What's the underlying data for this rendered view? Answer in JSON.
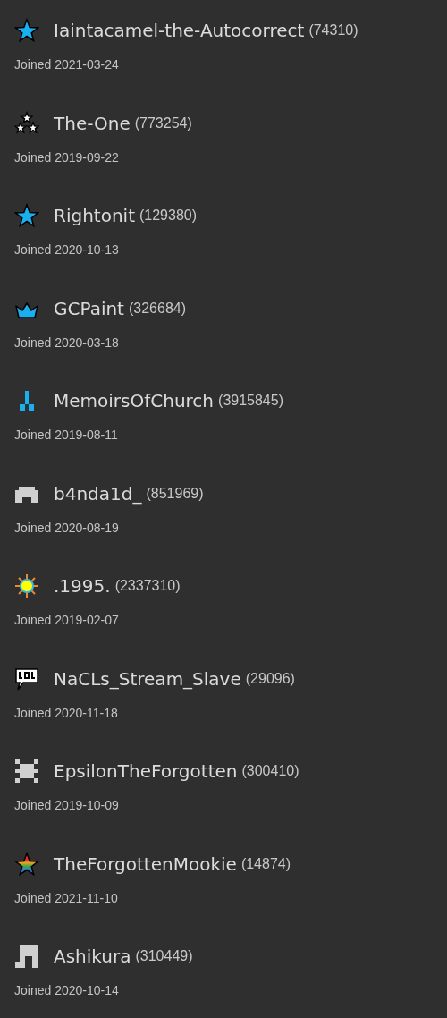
{
  "users": [
    {
      "kind": "star",
      "name": "Iaintacamel-the-Autocorrect",
      "points": "(74310)",
      "joined": "Joined 2021-03-24"
    },
    {
      "kind": "three-stars",
      "name": "The-One",
      "points": "(773254)",
      "joined": "Joined 2019-09-22"
    },
    {
      "kind": "star",
      "name": "Rightonit",
      "points": "(129380)",
      "joined": "Joined 2020-10-13"
    },
    {
      "kind": "crown",
      "name": "GCPaint",
      "points": "(326684)",
      "joined": "Joined 2020-03-18"
    },
    {
      "kind": "pixel-tee",
      "name": "MemoirsOfChurch",
      "points": "(3915845)",
      "joined": "Joined 2019-08-11"
    },
    {
      "kind": "pixel-blob",
      "name": "b4nda1d_",
      "points": "(851969)",
      "joined": "Joined 2020-08-19"
    },
    {
      "kind": "sun",
      "name": ".1995.",
      "points": "(2337310)",
      "joined": "Joined 2019-02-07"
    },
    {
      "kind": "lol",
      "name": "NaCLs_Stream_Slave",
      "points": "(29096)",
      "joined": "Joined 2020-11-18"
    },
    {
      "kind": "pixel-x",
      "name": "EpsilonTheForgotten",
      "points": "(300410)",
      "joined": "Joined 2019-10-09"
    },
    {
      "kind": "rainbow-star",
      "name": "TheForgottenMookie",
      "points": "(14874)",
      "joined": "Joined 2021-11-10"
    },
    {
      "kind": "pixel-arch",
      "name": "Ashikura",
      "points": "(310449)",
      "joined": "Joined 2020-10-14"
    }
  ]
}
